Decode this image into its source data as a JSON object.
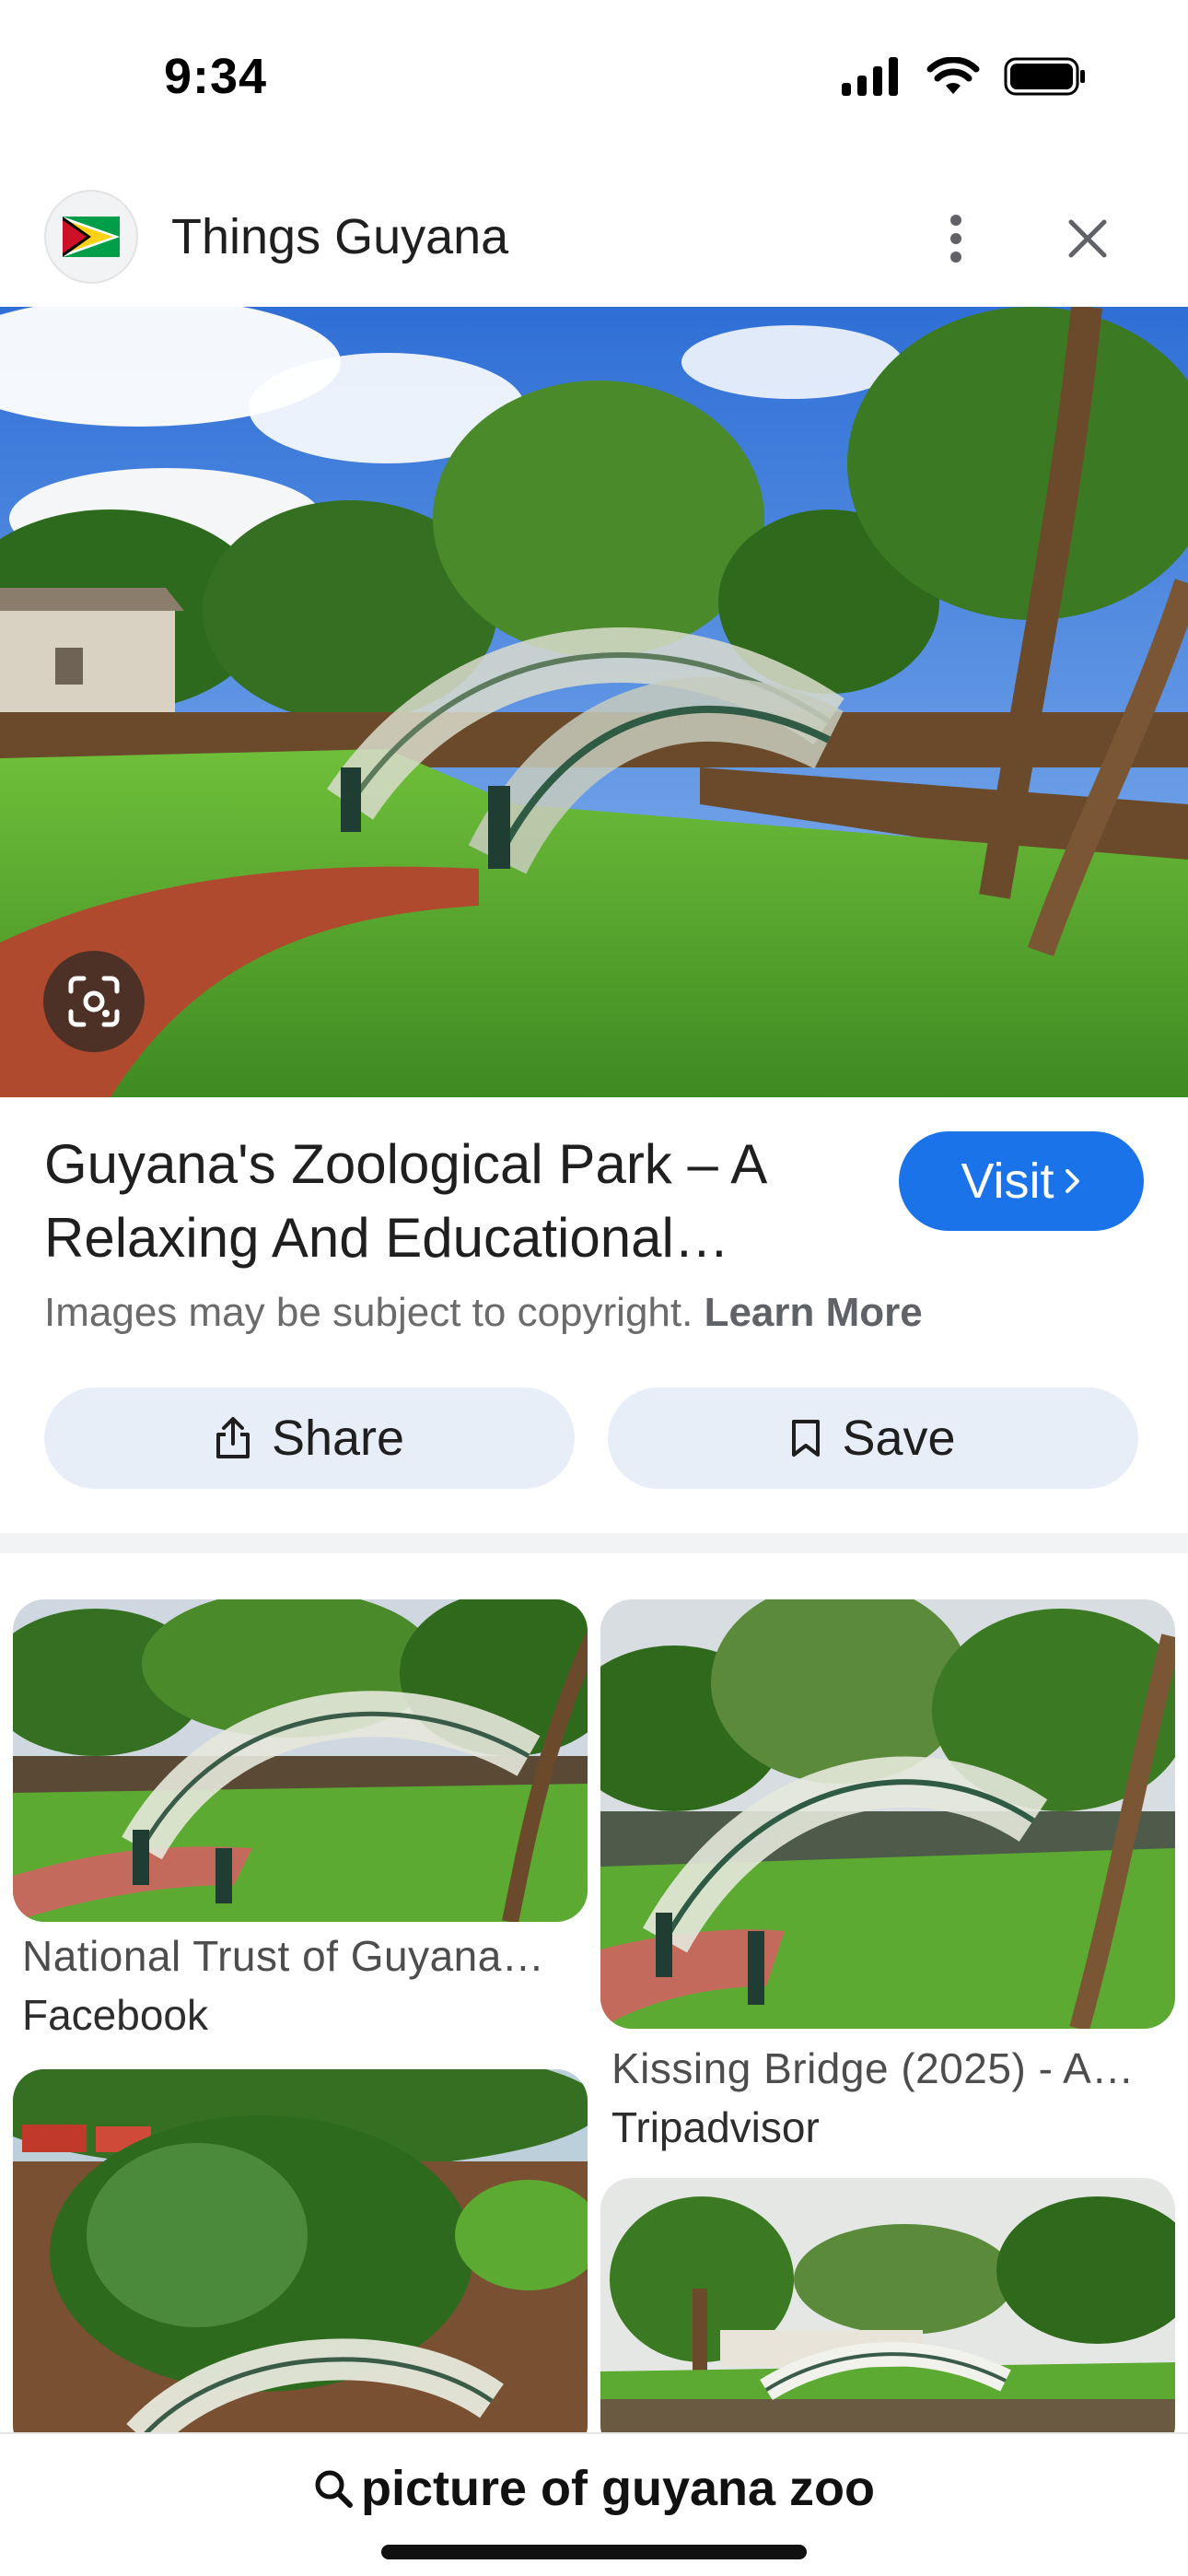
{
  "status_bar": {
    "time": "9:34"
  },
  "header": {
    "site_name": "Things Guyana",
    "logo_icon": "guyana-flag-icon"
  },
  "result": {
    "title": "Guyana's Zoological Park – A Relaxing And Educational…",
    "visit_label": "Visit",
    "copyright_text": "Images may be subject to copyright.",
    "learn_more": "Learn More",
    "share_label": "Share",
    "save_label": "Save"
  },
  "related": [
    {
      "title": "National Trust of Guyana…",
      "source": "Facebook"
    },
    {
      "title": "Kissing Bridge (2025) - A…",
      "source": "Tripadvisor"
    },
    {
      "title": "",
      "source": ""
    },
    {
      "title": "",
      "source": ""
    }
  ],
  "search": {
    "query": "picture of guyana zoo"
  },
  "colors": {
    "accent": "#1a73e8",
    "action_bg": "#e8eef8"
  }
}
